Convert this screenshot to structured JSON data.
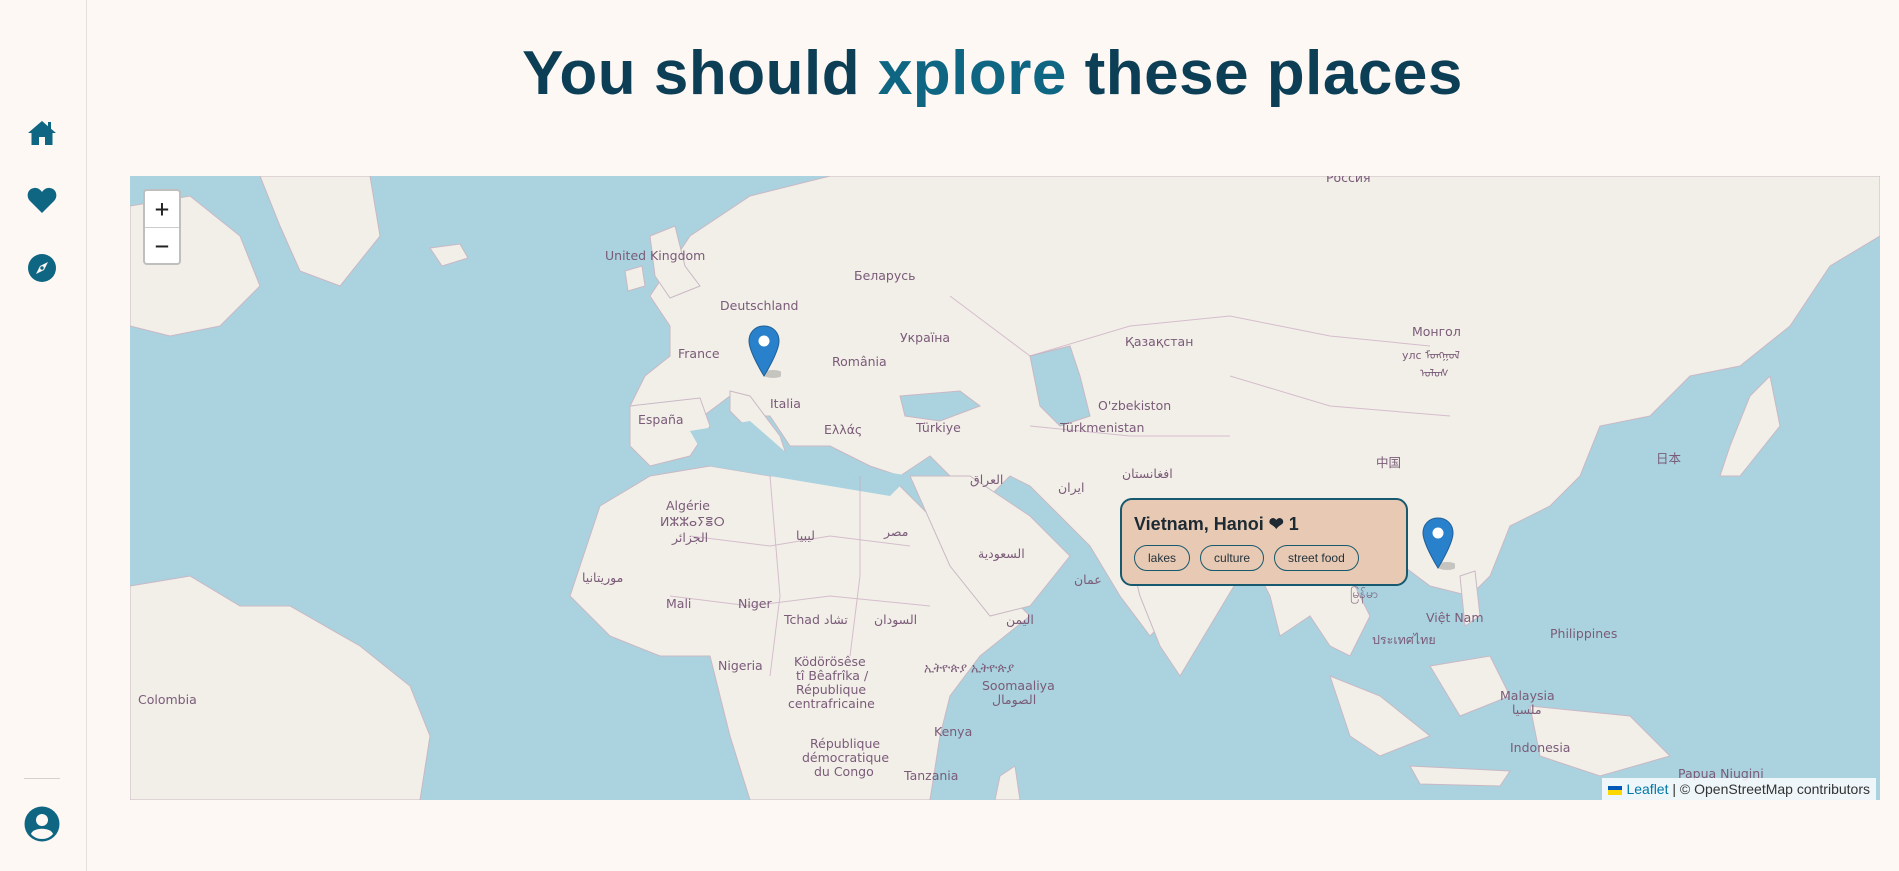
{
  "sidebar": {
    "items": [
      {
        "icon": "home-icon"
      },
      {
        "icon": "heart-icon"
      },
      {
        "icon": "compass-icon"
      }
    ],
    "profile_icon": "user-circle-icon"
  },
  "header": {
    "title_before": "You should ",
    "title_accent": "xplore",
    "title_after": " these places"
  },
  "map": {
    "zoom_in": "+",
    "zoom_out": "−",
    "labels": {
      "uk": "United Kingdom",
      "de": "Deutschland",
      "by": "Беларусь",
      "fr": "France",
      "ua": "Україна",
      "ro": "România",
      "kz": "Қазақстан",
      "mn1": "Монгол",
      "mn2": "улс ᠮᠤᠩᠭᠤᠯ",
      "mn3": "ᠤᠯᠤᠰ",
      "it": "Italia",
      "uz": "O'zbekiston",
      "es": "España",
      "gr": "Ελλάς",
      "tr": "Türkiye",
      "tm": "Türkmenistan",
      "cn": "中国",
      "jp": "日本",
      "iq": "العراق",
      "ir": "ایران",
      "af": "افغانستان",
      "dz1": "Algérie",
      "dz2": "ⵍⵣⵣⴰⵢⴻⵔ",
      "dz3": "الجزائر",
      "ly": "ليبيا",
      "eg": "مصر",
      "sa": "السعودية",
      "om": "عمان",
      "mr": "موريتانيا",
      "ml": "Mali",
      "ne": "Niger",
      "td": "Tchad تشاد",
      "sd": "السودان",
      "ye": "اليمن",
      "vn": "Việt Nam",
      "th": "ประเทศไทย",
      "ph": "Philippines",
      "ng": "Nigeria",
      "cf1": "Ködörösêse",
      "cf2": "tî Bêafrîka /",
      "cf3": "République",
      "cf4": "centrafricaine",
      "et": "ኢትዮጵያ ኢትዮጵያ",
      "so1": "Soomaaliya",
      "so2": "الصومال",
      "my1": "Malaysia",
      "my2": "ملسيا",
      "co": "Colombia",
      "ke": "Kenya",
      "cd1": "République",
      "cd2": "démocratique",
      "cd3": "du Congo",
      "tz": "Tanzania",
      "id": "Indonesia",
      "pg": "Papua Niugini",
      "ru": "Россия",
      "mm": "မြန်မာ"
    },
    "popup": {
      "title": "Vietnam, Hanoi ❤ 1",
      "tags": [
        "lakes",
        "culture",
        "street food"
      ]
    },
    "attribution": {
      "leaflet": "Leaflet",
      "rest": " | © OpenStreetMap contributors"
    }
  },
  "colors": {
    "primary": "#0c3f55",
    "accent": "#0e6683",
    "water": "#aad3df",
    "land": "#f2efe9",
    "popup_bg": "#e8c9b3",
    "marker": "#2a81cb"
  }
}
